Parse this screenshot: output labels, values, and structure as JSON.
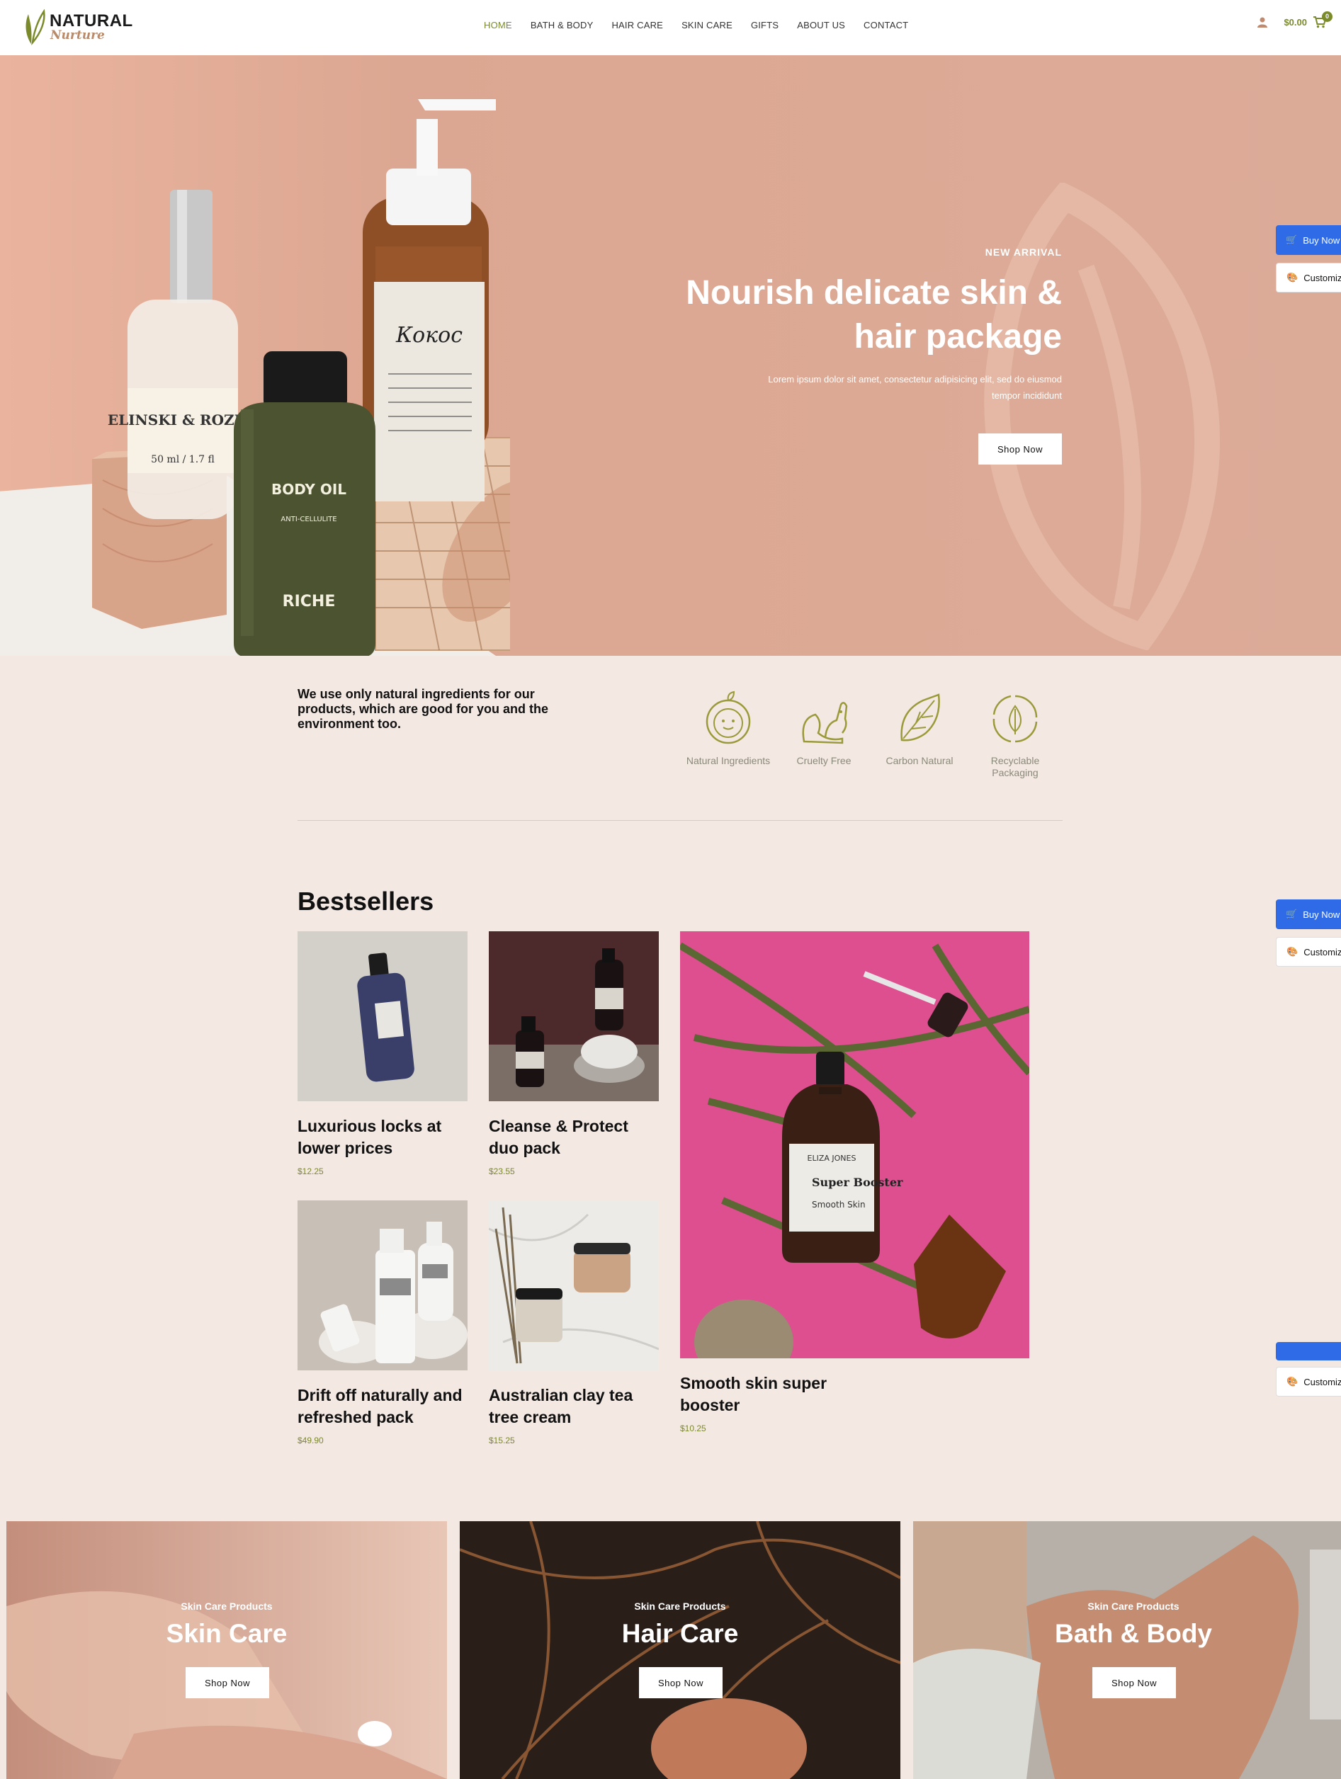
{
  "header": {
    "logo_line1": "NATURAL",
    "logo_line2": "Nurture",
    "nav": [
      {
        "label": "HOME"
      },
      {
        "label": "BATH & BODY"
      },
      {
        "label": "HAIR CARE"
      },
      {
        "label": "SKIN CARE"
      },
      {
        "label": "GIFTS"
      },
      {
        "label": "ABOUT US"
      },
      {
        "label": "CONTACT"
      }
    ],
    "cart_total": "$0.00",
    "cart_count": "0"
  },
  "hero": {
    "subtitle": "NEW ARRIVAL",
    "title": "Nourish delicate skin & hair package",
    "description": "Lorem ipsum dolor sit amet, consectetur adipisicing elit, sed do eiusmod tempor incididunt",
    "button": "Shop Now",
    "product_labels": {
      "spray": "ELINSKI & ROZEN",
      "spray_sub": "50 ml / 1.7 fl",
      "oil": "BODY OIL",
      "oil_sub": "ANTI-CELLULITE",
      "oil_brand": "RICHE",
      "pump": "Кокос"
    }
  },
  "floating": {
    "buy": "Buy Now",
    "customize": "Customize"
  },
  "features": {
    "text": "We use only natural ingredients for our products, which are good for you and the environment too.",
    "items": [
      {
        "label": "Natural Ingredients",
        "icon": "apple-face-icon"
      },
      {
        "label": "Cruelty Free",
        "icon": "squirrel-icon"
      },
      {
        "label": "Carbon Natural",
        "icon": "leaf-icon"
      },
      {
        "label": "Recyclable Packaging",
        "icon": "recycle-leaf-icon"
      }
    ]
  },
  "bestsellers": {
    "title": "Bestsellers",
    "products": [
      {
        "name": "Luxurious locks at lower prices",
        "price": "$12.25"
      },
      {
        "name": "Cleanse & Protect duo pack",
        "price": "$23.55"
      },
      {
        "name": "Drift off naturally and refreshed pack",
        "price": "$49.90"
      },
      {
        "name": "Australian clay tea tree cream",
        "price": "$15.25"
      },
      {
        "name": "Smooth skin super booster",
        "price": "$10.25",
        "label_brand": "ELIZA JONES",
        "label_name": "Super Booster",
        "label_sub": "Smooth Skin"
      }
    ]
  },
  "categories": [
    {
      "sub": "Skin Care Products",
      "title": "Skin Care",
      "button": "Shop Now"
    },
    {
      "sub": "Skin Care Products",
      "title": "Hair Care",
      "button": "Shop Now"
    },
    {
      "sub": "Skin Care Products",
      "title": "Bath & Body",
      "button": "Shop Now"
    }
  ],
  "colors": {
    "accent": "#7b8a2a",
    "hero_bg": "#dba996",
    "page_bg": "#f3e8e2",
    "buy_button": "#2f6be6"
  }
}
